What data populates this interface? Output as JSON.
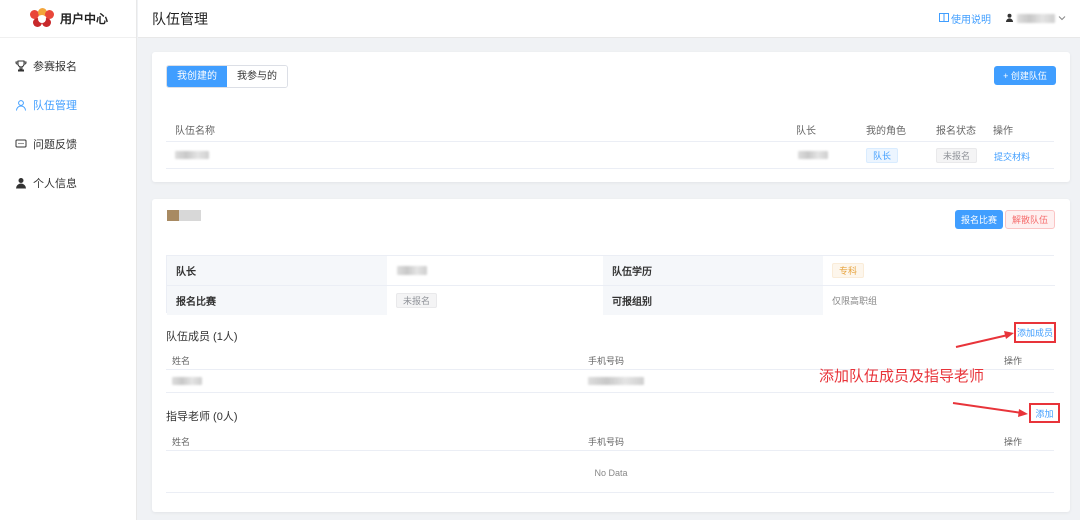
{
  "sidebar": {
    "brand": "用户中心",
    "items": [
      {
        "label": "参赛报名",
        "icon": "trophy-icon"
      },
      {
        "label": "队伍管理",
        "icon": "user-icon",
        "active": true
      },
      {
        "label": "问题反馈",
        "icon": "chat-icon"
      },
      {
        "label": "个人信息",
        "icon": "person-icon"
      }
    ]
  },
  "header": {
    "title": "队伍管理",
    "help": "使用说明"
  },
  "teams": {
    "tabs": [
      "我创建的",
      "我参与的"
    ],
    "create_button": "+ 创建队伍",
    "columns": [
      "队伍名称",
      "队长",
      "我的角色",
      "报名状态",
      "操作"
    ],
    "row": {
      "role": "队长",
      "status": "未报名",
      "action": "提交材料"
    }
  },
  "detail": {
    "signup_button": "报名比赛",
    "dissolve_button": "解散队伍",
    "info": {
      "captain_label": "队长",
      "edu_label": "队伍学历",
      "edu_value": "专科",
      "contest_label": "报名比赛",
      "contest_value": "未报名",
      "group_label": "可报组别",
      "group_value": "仅限高职组"
    },
    "members": {
      "title": "队伍成员 (1人)",
      "add_button": "添加成员",
      "columns": [
        "姓名",
        "手机号码",
        "操作"
      ]
    },
    "teachers": {
      "title": "指导老师 (0人)",
      "add_button": "添加",
      "columns": [
        "姓名",
        "手机号码",
        "操作"
      ],
      "empty": "No Data"
    }
  },
  "annotation": "添加队伍成员及指导老师",
  "colors": {
    "primary": "#409eff",
    "annotation": "#e8343a",
    "danger": "#f56c6c"
  }
}
